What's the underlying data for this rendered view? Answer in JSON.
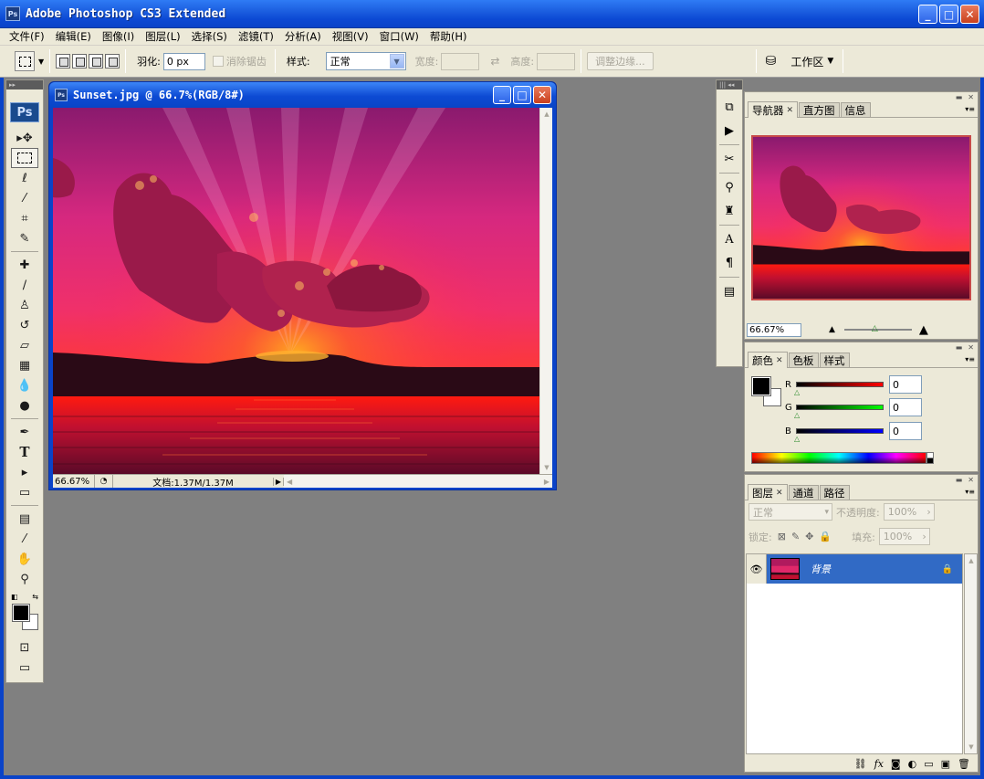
{
  "app": {
    "title": "Adobe Photoshop CS3 Extended",
    "icon_text": "Ps"
  },
  "window_controls": {
    "minimize": "_",
    "maximize": "□",
    "close": "✕"
  },
  "menu": [
    "文件(F)",
    "编辑(E)",
    "图像(I)",
    "图层(L)",
    "选择(S)",
    "滤镜(T)",
    "分析(A)",
    "视图(V)",
    "窗口(W)",
    "帮助(H)"
  ],
  "options": {
    "feather_label": "羽化:",
    "feather_value": "0 px",
    "antialias_label": "消除锯齿",
    "style_label": "样式:",
    "style_value": "正常",
    "width_label": "宽度:",
    "height_label": "高度:",
    "refine_edge_label": "调整边缘...",
    "workspace_label": "工作区"
  },
  "toolbox": {
    "logo": "Ps",
    "tools": [
      {
        "name": "move-tool",
        "glyph": "▸✥"
      },
      {
        "name": "rectangular-marquee-tool",
        "glyph": "⬚",
        "active": true
      },
      {
        "name": "lasso-tool",
        "glyph": "ℓ"
      },
      {
        "name": "quick-selection-tool",
        "glyph": "⁄"
      },
      {
        "name": "crop-tool",
        "glyph": "⌗"
      },
      {
        "name": "slice-tool",
        "glyph": "✎"
      },
      {
        "name": "healing-brush-tool",
        "glyph": "✚"
      },
      {
        "name": "brush-tool",
        "glyph": "∕"
      },
      {
        "name": "clone-stamp-tool",
        "glyph": "♙"
      },
      {
        "name": "history-brush-tool",
        "glyph": "↺"
      },
      {
        "name": "eraser-tool",
        "glyph": "▱"
      },
      {
        "name": "gradient-tool",
        "glyph": "▦"
      },
      {
        "name": "blur-tool",
        "glyph": "💧"
      },
      {
        "name": "dodge-tool",
        "glyph": "●"
      },
      {
        "name": "pen-tool",
        "glyph": "✒"
      },
      {
        "name": "type-tool",
        "glyph": "T"
      },
      {
        "name": "path-selection-tool",
        "glyph": "▸"
      },
      {
        "name": "rectangle-tool",
        "glyph": "▭"
      },
      {
        "name": "notes-tool",
        "glyph": "▤"
      },
      {
        "name": "eyedropper-tool",
        "glyph": "⁄"
      },
      {
        "name": "hand-tool",
        "glyph": "✋"
      },
      {
        "name": "zoom-tool",
        "glyph": "⚲"
      }
    ]
  },
  "document": {
    "title": "Sunset.jpg @ 66.7%(RGB/8#)",
    "icon_text": "Ps",
    "zoom": "66.67%",
    "doc_info": "文档:1.37M/1.37M"
  },
  "navigator": {
    "tabs": [
      {
        "label": "导航器",
        "active": true
      },
      {
        "label": "直方图"
      },
      {
        "label": "信息"
      }
    ],
    "zoom": "66.67%"
  },
  "color_panel": {
    "tabs": [
      {
        "label": "颜色",
        "active": true
      },
      {
        "label": "色板"
      },
      {
        "label": "样式"
      }
    ],
    "channels": [
      {
        "label": "R",
        "value": "0",
        "color": "#d40000"
      },
      {
        "label": "G",
        "value": "0",
        "color": "#00c800"
      },
      {
        "label": "B",
        "value": "0",
        "color": "#0000d4"
      }
    ]
  },
  "layers_panel": {
    "tabs": [
      {
        "label": "图层",
        "active": true
      },
      {
        "label": "通道"
      },
      {
        "label": "路径"
      }
    ],
    "blend_mode": "正常",
    "opacity_label": "不透明度:",
    "opacity_value": "100%",
    "lock_label": "锁定:",
    "fill_label": "填充:",
    "fill_value": "100%",
    "layers": [
      {
        "name": "背景",
        "locked": true
      }
    ]
  },
  "colors": {
    "titlebar_blue": "#0a43c8",
    "workspace_gray": "#808080",
    "panel_bg": "#ece9d8",
    "selection_blue": "#316ac5"
  }
}
